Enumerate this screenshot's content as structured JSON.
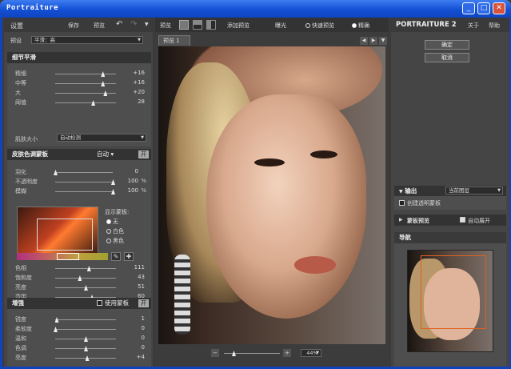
{
  "window": {
    "title": "Portraiture"
  },
  "left": {
    "settings_label": "设置",
    "save_label": "保存",
    "preview_label": "预览",
    "preset_label": "预设",
    "preset_value": "平滑：高",
    "detail": {
      "title": "细节平滑",
      "rows": [
        {
          "label": "精细",
          "value": "+16",
          "pos": 0.78
        },
        {
          "label": "中等",
          "value": "+16",
          "pos": 0.78
        },
        {
          "label": "大",
          "value": "+20",
          "pos": 0.82
        },
        {
          "label": "阈值",
          "value": "28",
          "pos": 0.62
        }
      ],
      "feature_label": "肌肤大小",
      "feature_value": "自动检测"
    },
    "skin": {
      "title": "皮肤色调蒙板",
      "mode": "自动",
      "toggle": "开",
      "rows": [
        {
          "label": "羽化",
          "value": "0",
          "pct": "",
          "pos": 0.0
        },
        {
          "label": "不透明度",
          "value": "100",
          "pct": "%",
          "pos": 1.0
        },
        {
          "label": "模糊",
          "value": "100",
          "pct": "%",
          "pos": 1.0
        }
      ],
      "display_label": "显示蒙板:",
      "radio": [
        "无",
        "白色",
        "黑色"
      ],
      "rows2": [
        {
          "label": "色相",
          "value": "111",
          "pos": 0.55
        },
        {
          "label": "饱和度",
          "value": "43",
          "pos": 0.4
        },
        {
          "label": "亮度",
          "value": "51",
          "pos": 0.5
        },
        {
          "label": "范围",
          "value": "60",
          "pos": 0.6
        }
      ]
    },
    "enhance": {
      "title": "增强",
      "use_mask": "使用蒙板",
      "toggle": "开",
      "rows": [
        {
          "label": "锐度",
          "value": "1",
          "pos": 0.02
        },
        {
          "label": "柔软度",
          "value": "0",
          "pos": 0.0
        },
        {
          "label": "温和",
          "value": "0",
          "pos": 0.5
        },
        {
          "label": "色调",
          "value": "0",
          "pos": 0.5
        },
        {
          "label": "亮度",
          "value": "+4",
          "pos": 0.52
        }
      ]
    }
  },
  "center": {
    "preview_label": "预览",
    "add_preview": "添加预览",
    "exposure": "曝光",
    "fast_preview": "快速预览",
    "accurate": "精确",
    "tab": "预览 1",
    "zoom": "44%"
  },
  "right": {
    "brand": "PORTRAITURE 2",
    "about": "关于",
    "help": "帮助",
    "ok": "确定",
    "cancel": "取消",
    "output_label": "输出",
    "output_value": "当前图层",
    "create_mask": "创建透明蒙板",
    "mask_preview": "蒙板预览",
    "auto_expand": "自动展开",
    "navigator": "导航"
  }
}
